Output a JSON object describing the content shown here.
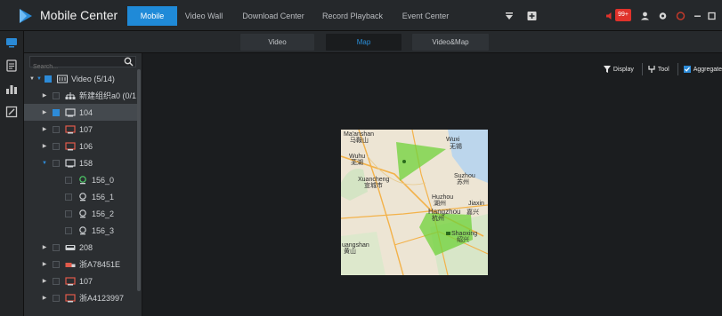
{
  "app": {
    "title": "Mobile Center"
  },
  "nav": {
    "tabs": [
      {
        "label": "Mobile",
        "active": true
      },
      {
        "label": "Video Wall",
        "active": false
      },
      {
        "label": "Download Center",
        "active": false
      },
      {
        "label": "Record Playback",
        "active": false
      },
      {
        "label": "Event Center",
        "active": false
      }
    ]
  },
  "topbar": {
    "alarm_badge": "99+",
    "icons": [
      "funnel-menu-icon",
      "add-box-icon",
      "alarm-speaker-icon",
      "user-icon",
      "settings-icon",
      "help-icon",
      "minimize-icon",
      "maximize-icon"
    ]
  },
  "rail": {
    "icons": [
      "monitor-icon",
      "list-icon",
      "report-icon",
      "edit-icon"
    ]
  },
  "subtabs": [
    {
      "label": "Video",
      "active": false
    },
    {
      "label": "Map",
      "active": true
    },
    {
      "label": "Video&Map",
      "active": false
    }
  ],
  "tree": {
    "search_placeholder": "Search...",
    "nodes": [
      {
        "label": "Video (5/14)",
        "icon": "video-root-icon"
      },
      {
        "label": "新建组织a0 (0/1",
        "icon": "org-icon"
      },
      {
        "label": "104",
        "icon": "vehicle-icon"
      },
      {
        "label": "107",
        "icon": "vehicle-icon"
      },
      {
        "label": "106",
        "icon": "vehicle-icon"
      },
      {
        "label": "158",
        "icon": "vehicle-icon"
      },
      {
        "label": "156_0",
        "icon": "camera-icon"
      },
      {
        "label": "156_1",
        "icon": "camera-icon"
      },
      {
        "label": "156_2",
        "icon": "camera-icon"
      },
      {
        "label": "156_3",
        "icon": "camera-icon"
      },
      {
        "label": "208",
        "icon": "bus-icon"
      },
      {
        "label": "浙A78451E",
        "icon": "truck-icon"
      },
      {
        "label": "107",
        "icon": "vehicle-icon"
      },
      {
        "label": "浙A4123997",
        "icon": "vehicle-icon"
      }
    ]
  },
  "tools": {
    "display": "Display",
    "tool": "Tool",
    "aggregate": "Aggregate"
  },
  "map": {
    "labels": [
      "Ma'anshan",
      "马鞍山",
      "Wuxi",
      "无锡",
      "Wuhu",
      "芜湖",
      "Xuancheng",
      "宣城市",
      "Suzhou",
      "苏州",
      "Huzhou",
      "湖州",
      "Hangzhou",
      "杭州",
      "嘉兴",
      "Jiaxin",
      "Shaoxing",
      "绍兴",
      "uangshan",
      "黄山"
    ]
  },
  "colors": {
    "accent": "#1f8ad8",
    "alarm": "#e0322b",
    "coverage": "#6fd13a"
  }
}
